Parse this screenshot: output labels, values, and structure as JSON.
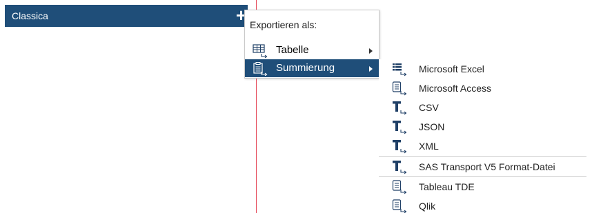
{
  "tab": {
    "label": "Classica",
    "add_symbol": "+"
  },
  "export_menu": {
    "header": "Exportieren als:",
    "items": [
      {
        "label": "Tabelle",
        "icon": "table-export-icon"
      },
      {
        "label": "Summierung",
        "icon": "clipboard-export-icon",
        "selected": true
      }
    ]
  },
  "format_menu": {
    "items": [
      {
        "label": "Microsoft Excel",
        "icon": "list-export-icon"
      },
      {
        "label": "Microsoft Access",
        "icon": "database-export-icon"
      },
      {
        "label": "CSV",
        "icon": "text-export-icon"
      },
      {
        "label": "JSON",
        "icon": "text-export-icon"
      },
      {
        "label": "XML",
        "icon": "text-export-icon"
      },
      {
        "label": "SAS Transport V5 Format-Datei",
        "icon": "text-export-icon"
      },
      {
        "label": "Tableau TDE",
        "icon": "database-export-icon"
      },
      {
        "label": "Qlik",
        "icon": "database-export-icon"
      }
    ]
  },
  "colors": {
    "accent": "#1f4e79",
    "icon": "#1f3f66",
    "divider": "#e64a5a"
  }
}
